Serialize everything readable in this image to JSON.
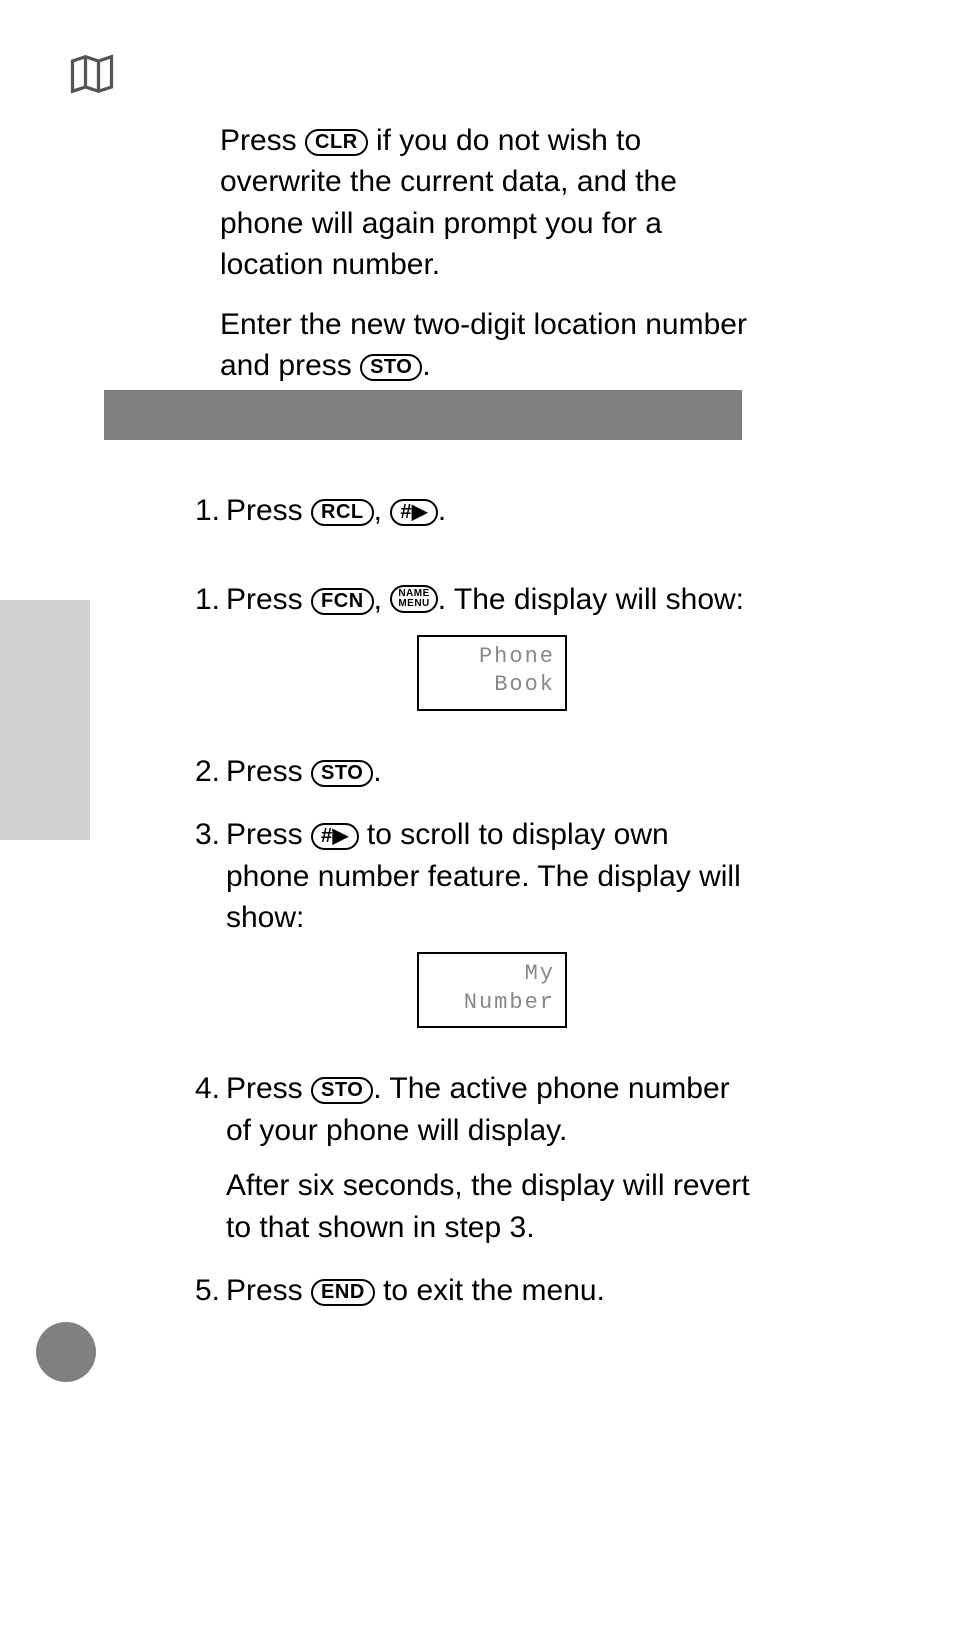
{
  "keys": {
    "clr": "CLR",
    "sto": "STO",
    "rcl": "RCL",
    "fcn": "FCN",
    "end": "END",
    "hash": "#▶",
    "name_menu_top": "NAME",
    "name_menu_bot": "MENU"
  },
  "intro": {
    "p1_before_clr": "Press ",
    "p1_after_clr": " if you do not wish to overwrite the current data, and the phone will again prompt you for a location number.",
    "p2_before_sto": "Enter the new two-digit location number and press ",
    "p2_after_sto": "."
  },
  "steps": [
    {
      "num": "1.",
      "pre": "Press ",
      "btn1": "rcl",
      "mid1": ", ",
      "btn2": "hash",
      "post": "."
    },
    {
      "num": "1.",
      "pre": "Press ",
      "btn1": "fcn",
      "mid1": ", ",
      "btn2": "name_menu",
      "post": ". The display will show:",
      "lcd": [
        "Phone",
        "Book"
      ]
    },
    {
      "num": "2.",
      "pre": "Press ",
      "btn1": "sto",
      "post": "."
    },
    {
      "num": "3.",
      "pre": "Press ",
      "btn1": "hash",
      "post": " to scroll to display own phone number feature. The display will show:",
      "lcd": [
        "My",
        "Number"
      ]
    },
    {
      "num": "4.",
      "pre": "Press ",
      "btn1": "sto",
      "post": ". The active phone number of your phone will display.",
      "extra": "After six seconds, the display will revert to that shown in step 3."
    },
    {
      "num": "5.",
      "pre": "Press ",
      "btn1": "end",
      "post": " to exit the menu."
    }
  ]
}
